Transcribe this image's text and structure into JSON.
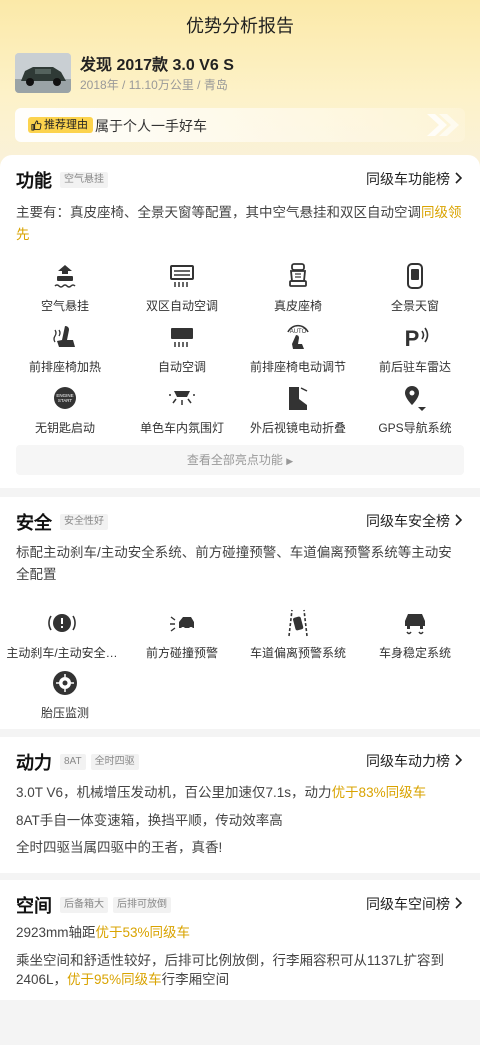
{
  "page": {
    "title": "优势分析报告"
  },
  "car": {
    "name": "发现 2017款 3.0 V6 S",
    "sub": "2018年 / 11.10万公里 / 青岛"
  },
  "reason": {
    "tag": "推荐理由",
    "text": "属于个人一手好车"
  },
  "function": {
    "title": "功能",
    "tag": "空气悬挂",
    "rank": "同级车功能榜",
    "desc_prefix": "主要有：真皮座椅、全景天窗等配置，其中空气悬挂和双区自动空调",
    "desc_hl": "同级领先",
    "items": [
      {
        "label": "空气悬挂",
        "icon": "air-suspension-icon"
      },
      {
        "label": "双区自动空调",
        "icon": "dual-zone-ac-icon"
      },
      {
        "label": "真皮座椅",
        "icon": "leather-seat-icon"
      },
      {
        "label": "全景天窗",
        "icon": "panoramic-sunroof-icon"
      },
      {
        "label": "前排座椅加热",
        "icon": "seat-heating-icon"
      },
      {
        "label": "自动空调",
        "icon": "auto-ac-icon"
      },
      {
        "label": "前排座椅电动调节",
        "icon": "power-seat-icon"
      },
      {
        "label": "前后驻车雷达",
        "icon": "parking-radar-icon"
      },
      {
        "label": "无钥匙启动",
        "icon": "keyless-start-icon"
      },
      {
        "label": "单色车内氛围灯",
        "icon": "ambient-light-icon"
      },
      {
        "label": "外后视镜电动折叠",
        "icon": "mirror-fold-icon"
      },
      {
        "label": "GPS导航系统",
        "icon": "gps-nav-icon"
      }
    ],
    "see_all": "查看全部亮点功能"
  },
  "safety": {
    "title": "安全",
    "tag": "安全性好",
    "rank": "同级车安全榜",
    "desc": "标配主动刹车/主动安全系统、前方碰撞预警、车道偏离预警系统等主动安全配置",
    "items": [
      {
        "label": "主动刹车/主动安全…",
        "icon": "active-brake-icon"
      },
      {
        "label": "前方碰撞预警",
        "icon": "collision-warning-icon"
      },
      {
        "label": "车道偏离预警系统",
        "icon": "lane-departure-icon"
      },
      {
        "label": "车身稳定系统",
        "icon": "stability-control-icon"
      },
      {
        "label": "胎压监测",
        "icon": "tire-pressure-icon"
      }
    ]
  },
  "power": {
    "title": "动力",
    "tags": [
      "8AT",
      "全时四驱"
    ],
    "rank": "同级车动力榜",
    "line1_prefix": "3.0T V6，机械增压发动机，百公里加速仅7.1s，动力",
    "line1_hl": "优于83%同级车",
    "line2": "8AT手自一体变速箱，换挡平顺，传动效率高",
    "line3": "全时四驱当属四驱中的王者，真香!"
  },
  "space": {
    "title": "空间",
    "tags": [
      "后备箱大",
      "后排可放倒"
    ],
    "rank": "同级车空间榜",
    "line1_prefix": "2923mm轴距",
    "line1_hl": "优于53%同级车",
    "line2a": "乘坐空间和舒适性较好，后排可比例放倒，行李厢容积可从1137L扩容到",
    "line2b_prefix": "2406L，",
    "line2b_hl": "优于95%同级车",
    "line2b_suffix": "行李厢空间"
  },
  "colors": {
    "accent": "#d9a300",
    "tag_bg": "#fcd34d"
  }
}
